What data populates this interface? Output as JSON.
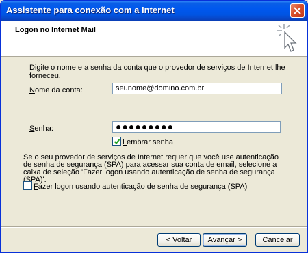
{
  "window": {
    "title": "Assistente para conexão com a Internet"
  },
  "header": {
    "title": "Logon no Internet Mail"
  },
  "content": {
    "instruction": "Digite o nome e a senha da conta que o provedor de serviços de Internet lhe forneceu.",
    "account_label_prefix": "N",
    "account_label_rest": "ome da conta:",
    "account_value": "seunome@domino.com.br",
    "password_label_prefix": "S",
    "password_label_rest": "enha:",
    "password_value": "●●●●●●●●●",
    "remember_label_prefix": "L",
    "remember_label_rest": "embrar senha",
    "remember_checked": true,
    "spa_text": "Se o seu provedor de serviços de Internet requer que você use autenticação de senha de segurança (SPA) para acessar sua conta de email, selecione a caixa de seleção 'Fazer logon usando autenticação de senha de segurança (SPA)'.",
    "spa_label_prefix": "F",
    "spa_label_rest": "azer logon usando autenticação de senha de segurança (SPA)",
    "spa_checked": false
  },
  "buttons": {
    "back_label_prefix": "< ",
    "back_label_u": "V",
    "back_label_rest": "oltar",
    "next_label_prefix": "A",
    "next_label_u": "v",
    "next_label_rest": "ançar >",
    "cancel_label": "Cancelar"
  },
  "colors": {
    "titlebar": "#0054e3",
    "close": "#d8502b",
    "window_bg": "#ece9d8",
    "accent_check": "#21a121"
  },
  "icons": {
    "close": "close-icon",
    "wizard": "wizard-sparkle-cursor-icon",
    "check": "checkmark-icon"
  }
}
